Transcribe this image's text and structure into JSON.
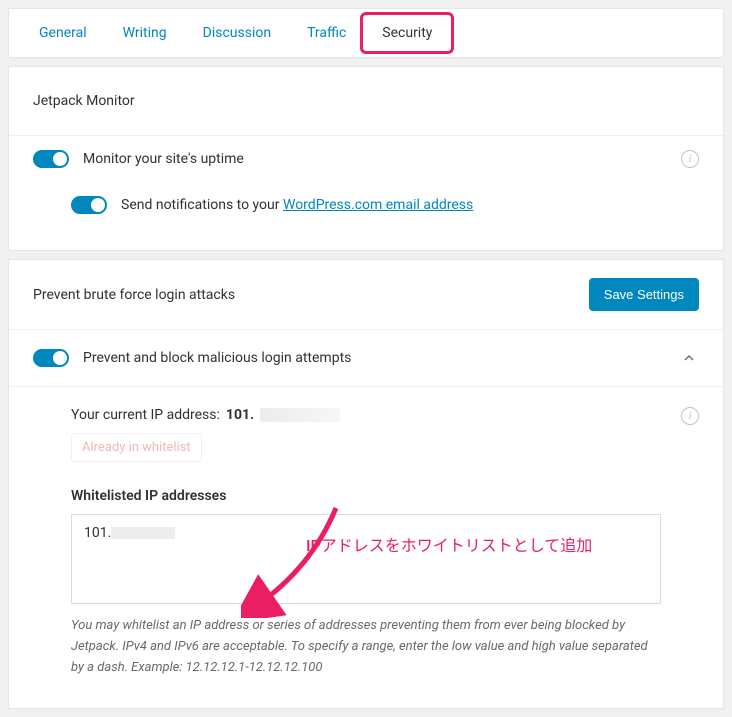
{
  "tabs": {
    "items": [
      {
        "label": "General",
        "active": false
      },
      {
        "label": "Writing",
        "active": false
      },
      {
        "label": "Discussion",
        "active": false
      },
      {
        "label": "Traffic",
        "active": false
      },
      {
        "label": "Security",
        "active": true
      }
    ]
  },
  "monitor": {
    "title": "Jetpack Monitor",
    "uptime_toggle_label": "Monitor your site's uptime",
    "notify_prefix": "Send notifications to your ",
    "notify_link": "WordPress.com email address"
  },
  "bruteforce": {
    "title": "Prevent brute force login attacks",
    "save_button": "Save Settings",
    "prevent_toggle_label": "Prevent and block malicious login attempts",
    "ip_label_prefix": "Your current IP address: ",
    "ip_value": "101.",
    "already_button": "Already in whitelist",
    "whitelist_label": "Whitelisted IP addresses",
    "whitelist_value": "101.",
    "hint": "You may whitelist an IP address or series of addresses preventing them from ever being blocked by Jetpack. IPv4 and IPv6 are acceptable. To specify a range, enter the low value and high value separated by a dash. Example: 12.12.12.1-12.12.12.100"
  },
  "annotation": {
    "text": "IPアドレスをホワイトリストとして追加"
  }
}
